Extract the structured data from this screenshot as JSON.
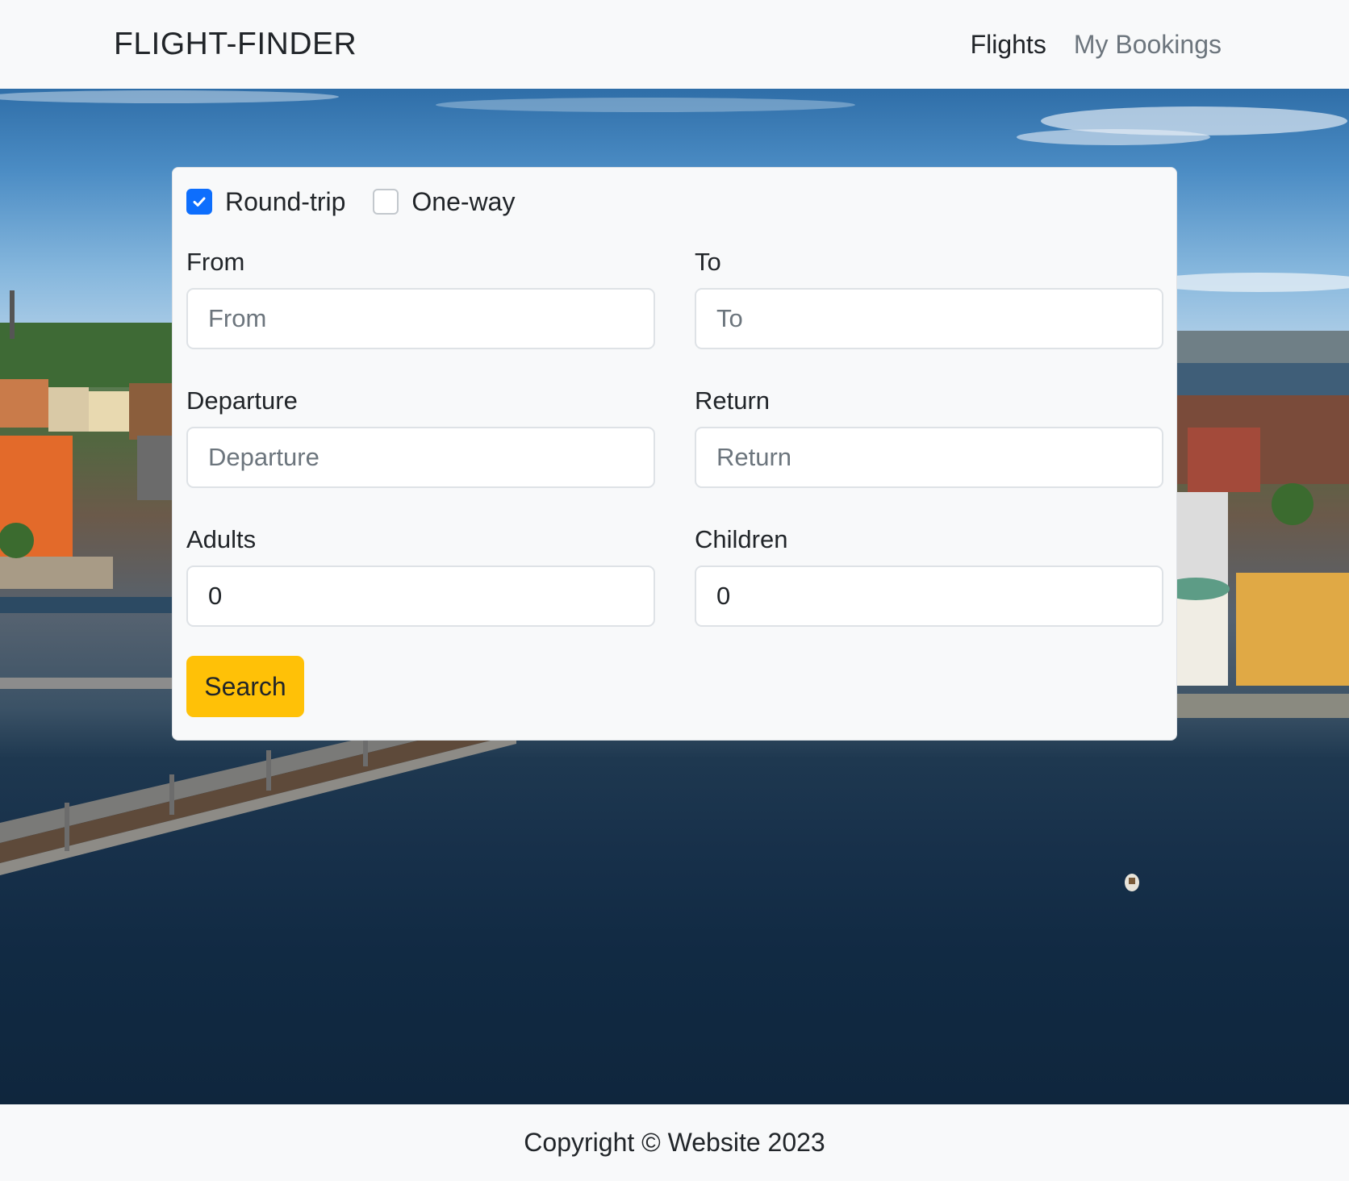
{
  "navbar": {
    "brand": "FLIGHT-FINDER",
    "links": [
      {
        "label": "Flights",
        "active": true
      },
      {
        "label": "My Bookings",
        "active": false
      }
    ]
  },
  "search_form": {
    "trip_types": [
      {
        "label": "Round-trip",
        "checked": true
      },
      {
        "label": "One-way",
        "checked": false
      }
    ],
    "from": {
      "label": "From",
      "placeholder": "From",
      "value": ""
    },
    "to": {
      "label": "To",
      "placeholder": "To",
      "value": ""
    },
    "departure": {
      "label": "Departure",
      "placeholder": "Departure",
      "value": ""
    },
    "return": {
      "label": "Return",
      "placeholder": "Return",
      "value": ""
    },
    "adults": {
      "label": "Adults",
      "value": "0"
    },
    "children": {
      "label": "Children",
      "value": "0"
    },
    "search_label": "Search"
  },
  "footer": {
    "text": "Copyright © Website 2023"
  },
  "colors": {
    "accent": "#0d6efd",
    "search_button": "#ffc107",
    "navbar_bg": "#f8f9fa"
  },
  "icons": {
    "checkmark": "check-icon"
  }
}
